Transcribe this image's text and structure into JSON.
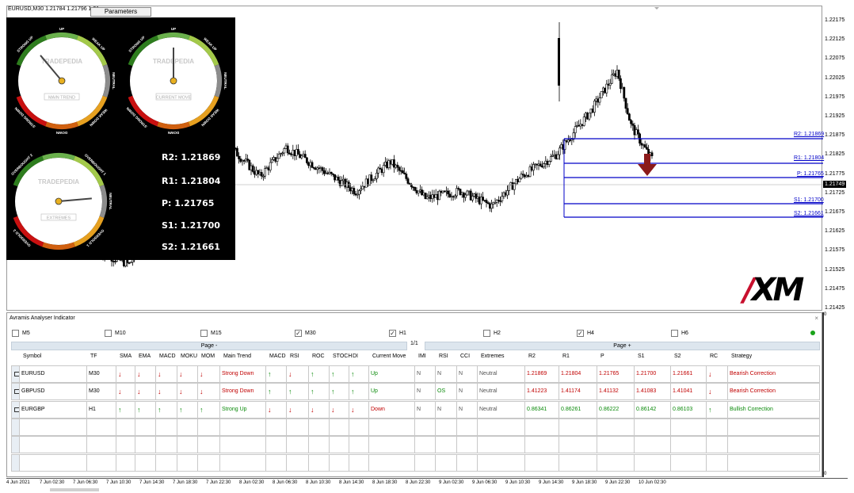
{
  "chart": {
    "symbol_info": "EURUSD,M30 1.21784 1.21796 1.21",
    "parameters_label": "Parameters",
    "current_price": "1.21749",
    "y_ticks": [
      "1.22175",
      "1.22125",
      "1.22075",
      "1.22025",
      "1.21975",
      "1.21925",
      "1.21875",
      "1.21825",
      "1.21775",
      "1.21725",
      "1.21675",
      "1.21625",
      "1.21575",
      "1.21525",
      "1.21475",
      "1.21425"
    ],
    "x_ticks": [
      "4 Jun 2021",
      "7 Jun 02:30",
      "7 Jun 06:30",
      "7 Jun 10:30",
      "7 Jun 14:30",
      "7 Jun 18:30",
      "7 Jun 22:30",
      "8 Jun 02:30",
      "8 Jun 06:30",
      "8 Jun 10:30",
      "8 Jun 14:30",
      "8 Jun 18:30",
      "8 Jun 22:30",
      "9 Jun 02:30",
      "9 Jun 06:30",
      "9 Jun 10:30",
      "9 Jun 14:30",
      "9 Jun 18:30",
      "9 Jun 22:30",
      "10 Jun 02:30"
    ],
    "pivot_labels": {
      "r2": "R2: 1.21869",
      "r1": "R1: 1.21804",
      "p": "P: 1.21765",
      "s1": "S1: 1.21700",
      "s2": "S2: 1.21661"
    },
    "line_color": "#0000c8",
    "signal_arrow_color": "#8b1a1a"
  },
  "dashboard": {
    "brand": "TRADEPEDIA",
    "gauges": [
      {
        "caption": "MAIN TREND",
        "top_label": "UP",
        "left_top": "STRONG UP",
        "right_top": "WEAK UP",
        "right": "NEUTRAL",
        "left_bottom": "STRONG DOWN",
        "right_bottom": "WEAK DOWN",
        "bottom": "DOWN"
      },
      {
        "caption": "CURRENT MOVE",
        "top_label": "UP",
        "left_top": "STRONG UP",
        "right_top": "WEAK UP",
        "right": "NEUTRAL",
        "left_bottom": "STRONG DOWN",
        "right_bottom": "WEAK DOWN",
        "bottom": "DOWN"
      },
      {
        "caption": "EXTREMES",
        "left_top": "OVERBOUGHT 2",
        "right_top": "OVERBOUGHT 1",
        "right": "NEUTRAL",
        "left_bottom": "OVERSOLD 2",
        "right_bottom": "OVERSOLD 1"
      }
    ],
    "levels": [
      "R2: 1.21869",
      "R1: 1.21804",
      "P: 1.21765",
      "S1: 1.21700",
      "S2: 1.21661"
    ]
  },
  "logo": "XM",
  "indicator": {
    "title": "Avramis Analyser Indicator",
    "close_glyph": "×",
    "timeframes": [
      {
        "label": "M5",
        "checked": false
      },
      {
        "label": "M10",
        "checked": false
      },
      {
        "label": "M15",
        "checked": false
      },
      {
        "label": "M30",
        "checked": true
      },
      {
        "label": "H1",
        "checked": true
      },
      {
        "label": "H2",
        "checked": false
      },
      {
        "label": "H4",
        "checked": true
      },
      {
        "label": "H6",
        "checked": false
      }
    ],
    "page_prev": "Page -",
    "page_next": "Page +",
    "page_count": "1/1",
    "headers": [
      "Symbol",
      "TF",
      "SMA",
      "EMA",
      "MACD",
      "MOKU",
      "MOM",
      "Main Trend",
      "MACD",
      "RSI",
      "ROC",
      "STOCH",
      "DI",
      "Current Move",
      "IMI",
      "RSI",
      "CCI",
      "Extremes",
      "R2",
      "R1",
      "P",
      "S1",
      "S2",
      "RC",
      "Strategy"
    ],
    "rows": [
      {
        "symbol": "EURUSD",
        "tf": "M30",
        "sma": "↓",
        "ema": "↓",
        "macd": "↓",
        "moku": "↓",
        "mom": "↓",
        "main_trend": "Strong Down",
        "macd2": "↑",
        "rsi": "↓",
        "roc": "↑",
        "stoch": "↑",
        "di": "↑",
        "current_move": "Up",
        "imi": "N",
        "rsi2": "N",
        "cci": "N",
        "extremes": "Neutral",
        "r2": "1.21869",
        "r1": "1.21804",
        "p": "1.21765",
        "s1": "1.21700",
        "s2": "1.21661",
        "rc": "↓",
        "strategy": "Bearish Correction"
      },
      {
        "symbol": "GBPUSD",
        "tf": "M30",
        "sma": "↓",
        "ema": "↓",
        "macd": "↓",
        "moku": "↓",
        "mom": "↓",
        "main_trend": "Strong Down",
        "macd2": "↑",
        "rsi": "↑",
        "roc": "↑",
        "stoch": "↑",
        "di": "↑",
        "current_move": "Up",
        "imi": "N",
        "rsi2": "OS",
        "cci": "N",
        "extremes": "Neutral",
        "r2": "1.41223",
        "r1": "1.41174",
        "p": "1.41132",
        "s1": "1.41083",
        "s2": "1.41041",
        "rc": "↓",
        "strategy": "Bearish Correction"
      },
      {
        "symbol": "EURGBP",
        "tf": "H1",
        "sma": "↑",
        "ema": "↑",
        "macd": "↑",
        "moku": "↑",
        "mom": "↑",
        "main_trend": "Strong Up",
        "macd2": "↓",
        "rsi": "↓",
        "roc": "↓",
        "stoch": "↓",
        "di": "↓",
        "current_move": "Down",
        "imi": "N",
        "rsi2": "N",
        "cci": "N",
        "extremes": "Neutral",
        "r2": "0.86341",
        "r1": "0.86261",
        "p": "0.86222",
        "s1": "0.86142",
        "s2": "0.86103",
        "rc": "↑",
        "strategy": "Bullish Correction"
      }
    ],
    "scale_zero": "0"
  }
}
